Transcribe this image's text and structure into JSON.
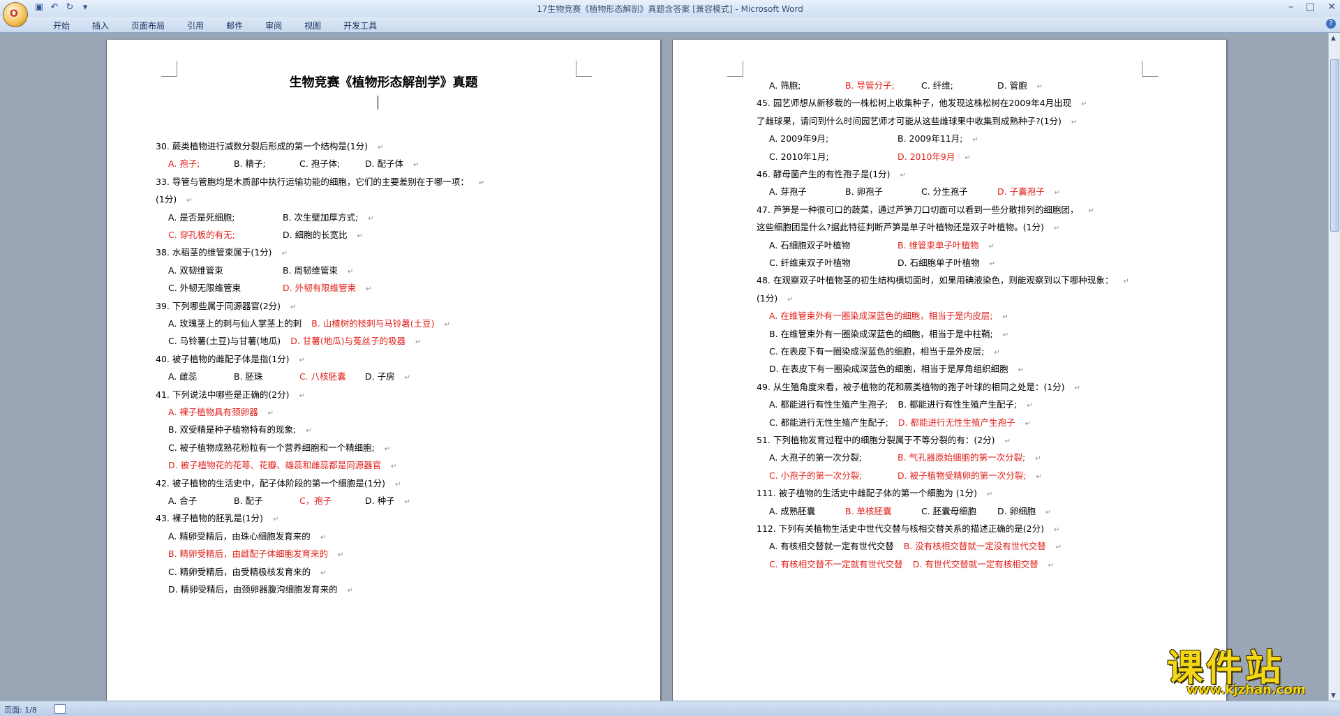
{
  "window": {
    "title": "17生物竞赛《植物形态解剖》真题含答案 [兼容模式] - Microsoft Word",
    "office_button": "O",
    "qat_icons": [
      "save-icon",
      "undo-icon",
      "redo-icon",
      "customize-icon"
    ],
    "controls": {
      "minimize": "–",
      "maximize": "□",
      "close": "✕"
    }
  },
  "ribbon": {
    "tabs": [
      "开始",
      "插入",
      "页面布局",
      "引用",
      "邮件",
      "审阅",
      "视图",
      "开发工具"
    ],
    "help": "?"
  },
  "status": {
    "page": "页面: 1/8"
  },
  "watermark": {
    "logo": "课件站",
    "url": "www.kjzhan.com"
  },
  "document": {
    "title": "生物竞赛《植物形态解剖学》真题",
    "page1_lines": [
      {
        "segs": [
          {
            "t": "30. 蕨类植物进行减数分裂后形成的第一个结构是(1分)"
          }
        ]
      },
      {
        "segs": [
          {
            "t": "A. 孢子;",
            "red": true
          },
          {
            "t": "B. 精子;"
          },
          {
            "t": "C. 孢子体;"
          },
          {
            "t": "D. 配子体"
          }
        ]
      },
      {
        "segs": [
          {
            "t": "33. 导管与管胞均是木质部中执行运输功能的细胞，它们的主要差别在于哪一项："
          }
        ]
      },
      {
        "segs": [
          {
            "t": "(1分)"
          }
        ]
      },
      {
        "segs": [
          {
            "t": "A. 是否是死细胞;"
          },
          {
            "t": "B. 次生壁加厚方式;"
          }
        ]
      },
      {
        "segs": [
          {
            "t": "C. 穿孔板的有无;",
            "red": true
          },
          {
            "t": "D. 细胞的长宽比"
          }
        ]
      },
      {
        "segs": [
          {
            "t": "38. 水稻茎的维管束属于(1分)"
          }
        ]
      },
      {
        "segs": [
          {
            "t": "A. 双韧维管束"
          },
          {
            "t": "B. 周韧维管束"
          }
        ]
      },
      {
        "segs": [
          {
            "t": "C. 外韧无限维管束"
          },
          {
            "t": "D. 外韧有限维管束",
            "red": true
          }
        ]
      },
      {
        "segs": [
          {
            "t": "39. 下列哪些属于同源器官(2分)"
          }
        ]
      },
      {
        "segs": [
          {
            "t": "A. 玫瑰茎上的刺与仙人掌茎上的刺"
          },
          {
            "t": "B. 山楂树的枝刺与马铃薯(土豆)",
            "red": true
          }
        ]
      },
      {
        "segs": [
          {
            "t": "C. 马铃薯(土豆)与甘薯(地瓜)"
          },
          {
            "t": "D. 甘薯(地瓜)与菟丝子的吸器",
            "red": true
          }
        ]
      },
      {
        "segs": [
          {
            "t": "40. 被子植物的雌配子体是指(1分)"
          }
        ]
      },
      {
        "segs": [
          {
            "t": "A. 雌蕊"
          },
          {
            "t": "B. 胚珠"
          },
          {
            "t": "C. 八核胚囊",
            "red": true
          },
          {
            "t": "D. 子房"
          }
        ]
      },
      {
        "segs": [
          {
            "t": "41. 下列说法中哪些是正确的(2分)"
          }
        ]
      },
      {
        "segs": [
          {
            "t": "A. 裸子植物具有颈卵器",
            "red": true
          }
        ]
      },
      {
        "segs": [
          {
            "t": "B. 双受精是种子植物特有的现象;"
          }
        ]
      },
      {
        "segs": [
          {
            "t": "C. 被子植物成熟花粉粒有一个营养细胞和一个精细胞;"
          }
        ]
      },
      {
        "segs": [
          {
            "t": "D. 被子植物花的花萼、花瓣、雄蕊和雌蕊都是同源器官",
            "red": true
          }
        ]
      },
      {
        "segs": [
          {
            "t": "42. 被子植物的生活史中，配子体阶段的第一个细胞是(1分)"
          }
        ]
      },
      {
        "segs": [
          {
            "t": "A. 合子"
          },
          {
            "t": "B. 配子"
          },
          {
            "t": "C，孢子",
            "red": true
          },
          {
            "t": "D. 种子"
          }
        ]
      },
      {
        "segs": [
          {
            "t": "43. 裸子植物的胚乳是(1分)"
          }
        ]
      },
      {
        "segs": [
          {
            "t": "A. 精卵受精后，由珠心细胞发育来的"
          }
        ]
      },
      {
        "segs": [
          {
            "t": "B. 精卵受精后，由雌配子体细胞发育来的",
            "red": true
          }
        ]
      },
      {
        "segs": [
          {
            "t": "C. 精卵受精后，由受精极核发育来的"
          }
        ]
      },
      {
        "segs": [
          {
            "t": "D. 精卵受精后，由颈卵器腹沟细胞发育来的"
          }
        ]
      }
    ],
    "page2_lines": [
      {
        "segs": [
          {
            "t": "A. 筛胞;"
          },
          {
            "t": "B. 导管分子;",
            "red": true
          },
          {
            "t": "C. 纤维;"
          },
          {
            "t": "D. 管胞"
          }
        ]
      },
      {
        "segs": [
          {
            "t": "45. 园艺师想从新移栽的一株松树上收集种子，他发现这株松树在2009年4月出现"
          }
        ]
      },
      {
        "segs": [
          {
            "t": "了雌球果，请问到什么时间园艺师才可能从这些雌球果中收集到成熟种子?(1分)"
          }
        ]
      },
      {
        "segs": [
          {
            "t": "A. 2009年9月;"
          },
          {
            "t": "B. 2009年11月;"
          }
        ]
      },
      {
        "segs": [
          {
            "t": "C. 2010年1月;"
          },
          {
            "t": "D. 2010年9月",
            "red": true
          }
        ]
      },
      {
        "segs": [
          {
            "t": "46. 酵母菌产生的有性孢子是(1分)"
          }
        ]
      },
      {
        "segs": [
          {
            "t": "A. 芽孢子"
          },
          {
            "t": "B. 卵孢子"
          },
          {
            "t": "C. 分生孢子"
          },
          {
            "t": "D. 子囊孢子",
            "red": true
          }
        ]
      },
      {
        "segs": [
          {
            "t": "47. 芦笋是一种很可口的蔬菜，通过芦笋刀口切面可以看到一些分散排列的细胞团，"
          }
        ]
      },
      {
        "segs": [
          {
            "t": "这些细胞团是什么?据此特征判断芦笋是单子叶植物还是双子叶植物。(1分)"
          }
        ]
      },
      {
        "segs": [
          {
            "t": "A. 石细胞双子叶植物"
          },
          {
            "t": "B. 维管束单子叶植物",
            "red": true
          }
        ]
      },
      {
        "segs": [
          {
            "t": "C. 纤维束双子叶植物"
          },
          {
            "t": "D. 石细胞单子叶植物"
          }
        ]
      },
      {
        "segs": [
          {
            "t": "48. 在观察双子叶植物茎的初生结构横切面时，如果用碘液染色，则能观察到以下哪种现象："
          }
        ]
      },
      {
        "segs": [
          {
            "t": "(1分)"
          }
        ]
      },
      {
        "segs": [
          {
            "t": "A. 在维管束外有一圈染成深蓝色的细胞，相当于是内皮层;",
            "red": true
          }
        ]
      },
      {
        "segs": [
          {
            "t": "B. 在维管束外有一圈染成深蓝色的细胞，相当于是中柱鞘;"
          }
        ]
      },
      {
        "segs": [
          {
            "t": "C. 在表皮下有一圈染成深蓝色的细胞，相当于是外皮层;"
          }
        ]
      },
      {
        "segs": [
          {
            "t": "D. 在表皮下有一圈染成深蓝色的细胞，相当于是厚角组织细胞"
          }
        ]
      },
      {
        "segs": [
          {
            "t": "49. 从生殖角度来看，被子植物的花和蕨类植物的孢子叶球的相同之处是：(1分)"
          }
        ]
      },
      {
        "segs": [
          {
            "t": "A. 都能进行有性生殖产生孢子;"
          },
          {
            "t": "B. 都能进行有性生殖产生配子;"
          }
        ]
      },
      {
        "segs": [
          {
            "t": "C. 都能进行无性生殖产生配子;"
          },
          {
            "t": "D. 都能进行无性生殖产生孢子",
            "red": true
          }
        ]
      },
      {
        "segs": [
          {
            "t": "51. 下列植物发育过程中的细胞分裂属于不等分裂的有：(2分)"
          }
        ]
      },
      {
        "segs": [
          {
            "t": "A. 大孢子的第一次分裂;"
          },
          {
            "t": "B. 气孔器原始细胞的第一次分裂;",
            "red": true
          }
        ]
      },
      {
        "segs": [
          {
            "t": "C. 小孢子的第一次分裂;",
            "red": true
          },
          {
            "t": "D. 被子植物受精卵的第一次分裂;",
            "red": true
          }
        ]
      },
      {
        "segs": [
          {
            "t": "111. 被子植物的生活史中雌配子体的第一个细胞为 (1分)"
          }
        ]
      },
      {
        "segs": [
          {
            "t": "A. 成熟胚囊"
          },
          {
            "t": "B. 单核胚囊",
            "red": true
          },
          {
            "t": "C. 胚囊母细胞"
          },
          {
            "t": "D. 卵细胞"
          }
        ]
      },
      {
        "segs": [
          {
            "t": "112. 下列有关植物生活史中世代交替与核相交替关系的描述正确的是(2分)"
          }
        ]
      },
      {
        "segs": [
          {
            "t": "A. 有核相交替就一定有世代交替"
          },
          {
            "t": "B. 没有核相交替就一定没有世代交替",
            "red": true
          }
        ]
      },
      {
        "segs": [
          {
            "t": "C. 有核相交替不一定就有世代交替",
            "red": true
          },
          {
            "t": "D. 有世代交替就一定有核相交替",
            "red": true
          }
        ]
      }
    ]
  }
}
